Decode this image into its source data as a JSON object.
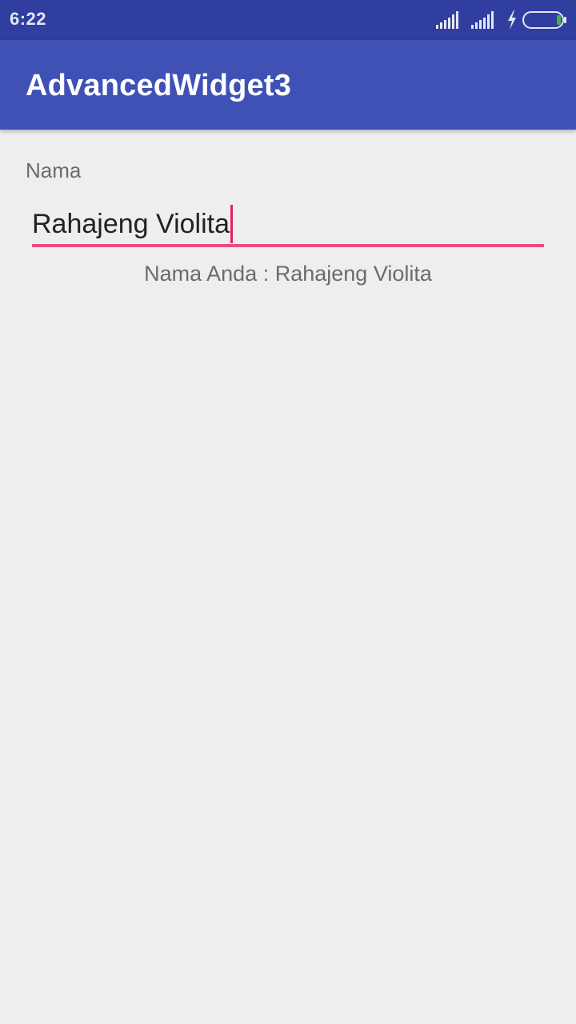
{
  "status_bar": {
    "time": "6:22",
    "icons": [
      "signal-icon",
      "signal-icon",
      "charging-icon",
      "battery-icon"
    ],
    "bg_color": "#303f9f"
  },
  "app_bar": {
    "title": "AdvancedWidget3",
    "bg_color": "#3f51b5"
  },
  "form": {
    "label": "Nama",
    "input_value": "Rahajeng Violita",
    "accent_color": "#e91e63"
  },
  "result": {
    "text": "Nama Anda : Rahajeng Violita"
  }
}
